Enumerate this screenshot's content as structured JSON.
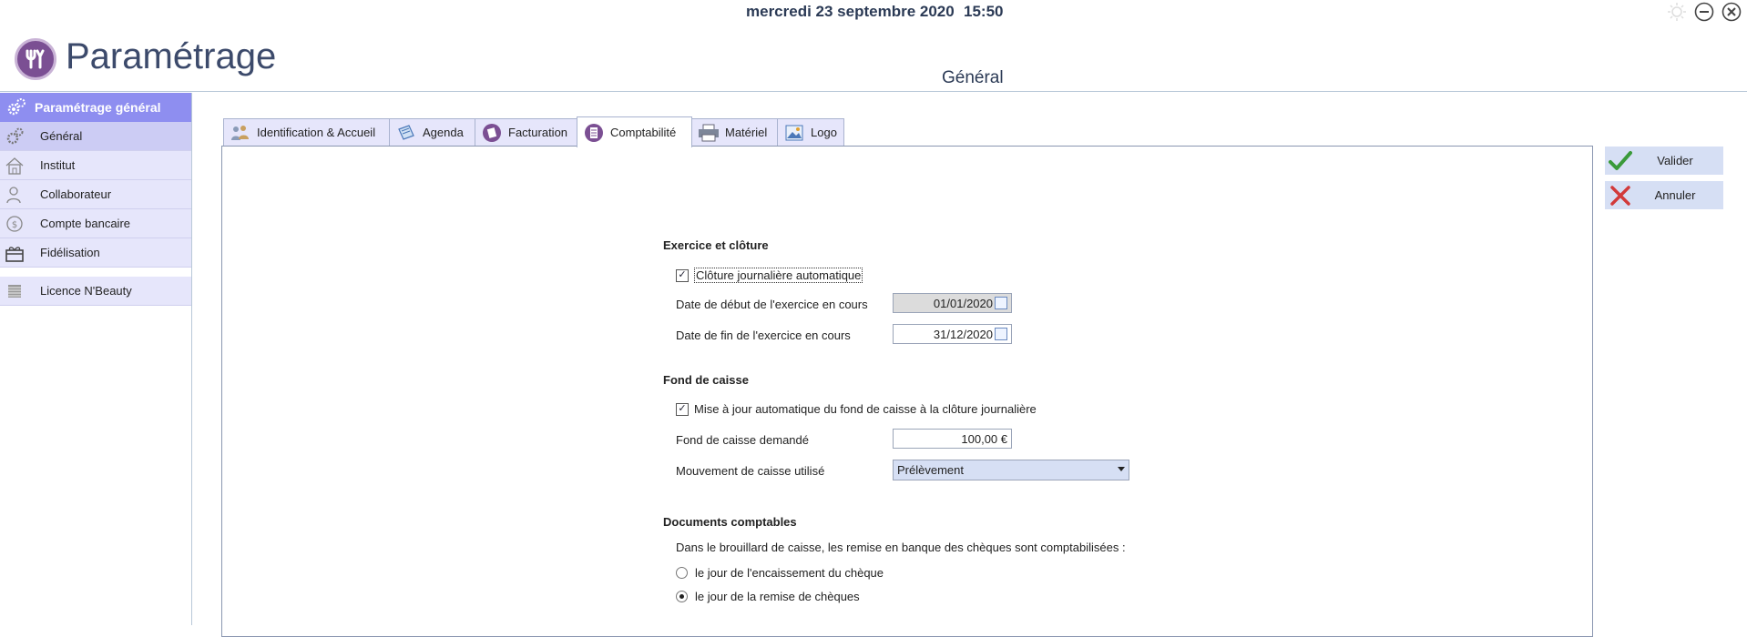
{
  "topbar": {
    "date": "mercredi 23 septembre 2020",
    "time": "15:50"
  },
  "header": {
    "app_title": "Paramétrage",
    "section_title": "Général"
  },
  "sidebar": {
    "header_label": "Paramétrage général",
    "items": [
      {
        "label": "Général",
        "icon": "gear-icon"
      },
      {
        "label": "Institut",
        "icon": "house-icon"
      },
      {
        "label": "Collaborateur",
        "icon": "person-icon"
      },
      {
        "label": "Compte bancaire",
        "icon": "coin-icon"
      },
      {
        "label": "Fidélisation",
        "icon": "gift-icon"
      }
    ],
    "license_label": "Licence N'Beauty"
  },
  "tabs": [
    {
      "label": "Identification & Accueil",
      "icon": "people-icon"
    },
    {
      "label": "Agenda",
      "icon": "agenda-icon"
    },
    {
      "label": "Facturation",
      "icon": "invoice-icon"
    },
    {
      "label": "Comptabilité",
      "icon": "accounting-icon",
      "active": true
    },
    {
      "label": "Matériel",
      "icon": "printer-icon"
    },
    {
      "label": "Logo",
      "icon": "image-icon"
    }
  ],
  "form": {
    "exercice": {
      "heading": "Exercice et clôture",
      "auto_close_label": "Clôture journalière automatique",
      "auto_close_checked": true,
      "start_label": "Date de début de l'exercice en cours",
      "start_value": "01/01/2020",
      "end_label": "Date de fin de l'exercice en cours",
      "end_value": "31/12/2020"
    },
    "fond": {
      "heading": "Fond de caisse",
      "auto_update_label": "Mise à jour automatique du fond de caisse à la clôture journalière",
      "auto_update_checked": true,
      "demand_label": "Fond de caisse demandé",
      "demand_value": "100,00 €",
      "movement_label": "Mouvement de caisse utilisé",
      "movement_value": "Prélèvement"
    },
    "documents": {
      "heading": "Documents comptables",
      "description": "Dans le brouillard de caisse, les remise en banque des chèques sont comptabilisées :",
      "option1": "le jour de l'encaissement du chèque",
      "option2": "le jour de la remise de chèques",
      "selected": 2
    }
  },
  "actions": {
    "validate_label": "Valider",
    "cancel_label": "Annuler"
  },
  "colors": {
    "accent": "#8e8ef0",
    "sidebar_bg": "#e6e6fb",
    "title": "#3c4a6b",
    "validate": "#3a9a3a",
    "cancel": "#d23a3a"
  }
}
